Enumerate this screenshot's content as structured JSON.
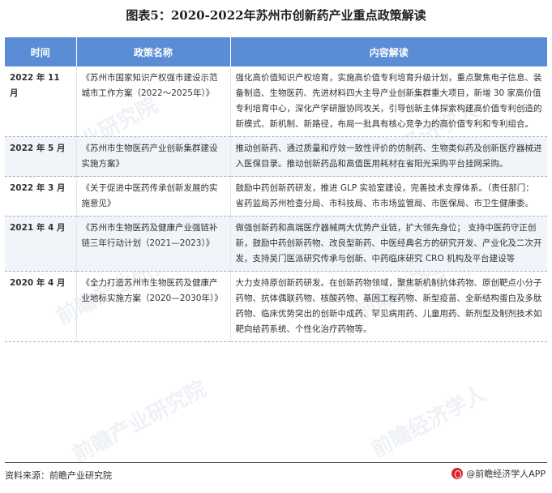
{
  "title": "图表5：2020-2022年苏州市创新药产业重点政策解读",
  "table": {
    "headers": [
      "时间",
      "政策名称",
      "内容解读"
    ],
    "rows": [
      {
        "time": "2022 年 11 月",
        "name": "《苏州市国家知识产权强市建设示范城市工作方案（2022～2025年）》",
        "content": "强化高价值知识产权培育，实施高价值专利培育升级计划，重点聚焦电子信息、装备制造、生物医药、先进材料四大主导产业创新集群重大项目，新增 30 家高价值专利培育中心，深化产学研服协同攻关，引导创新主体探索构建高价值专利创造的新模式、新机制、新路径，布局一批具有核心竞争力的高价值专利和专利组合。"
      },
      {
        "time": "2022 年 5 月",
        "name": "《苏州市生物医药产业创新集群建设实施方案》",
        "content": "推动创新药、通过质量和疗效一致性评价的仿制药、生物类似药及创新医疗器械进入医保目录。推动创新药品和高值医用耗材在省阳光采购平台挂网采购。"
      },
      {
        "time": "2022 年 3 月",
        "name": "《关于促进中医药传承创新发展的实施意见》",
        "content": "鼓励中药创新药研发，推进 GLP 实验室建设，完善技术支撑体系。（责任部门：省药监局苏州检查分局、市科技局、市市场监管局、市医保局、市卫生健康委。"
      },
      {
        "time": "2021 年 4 月",
        "name": "《苏州市生物医药及健康产业强链补链三年行动计划（2021—2023）》",
        "content": "做强创新药和高端医疗器械两大优势产业链，扩大领先身位；  支持中医药守正创新，鼓励中药创新药物、改良型新药、中医经典名方的研究开发、产业化及二次开发，支持吴门医派研究传承与创新、中药临床研究 CRO 机构及平台建设等"
      },
      {
        "time": "2020 年 4 月",
        "name": "《全力打造苏州市生物医药及健康产业地标实施方案（2020—2030年）》",
        "content": "大力支持原创新药研发。在创新药物领域，聚焦新机制抗体药物、原创靶点小分子药物、抗体偶联药物、核酸药物、基因工程药物、新型疫苗、全新结构蛋白及多肽药物、临床优势突出的创新中成药、罕见病用药、儿童用药、新剂型及制剂技术如靶向给药系统、个性化治疗药物等。"
      }
    ]
  },
  "footer": {
    "source": "资料来源：前瞻产业研究院",
    "brand": "@前瞻经济学人APP"
  },
  "colors": {
    "header_bg": "#5b8dd6",
    "alt_row_bg": "#f1f4f9",
    "logo": "#d8262e"
  },
  "icons": {
    "brand_logo": "qianzhan-logo-icon"
  },
  "watermark": {
    "text_a": "前瞻产业研究院",
    "text_b": "前瞻经济学人"
  }
}
